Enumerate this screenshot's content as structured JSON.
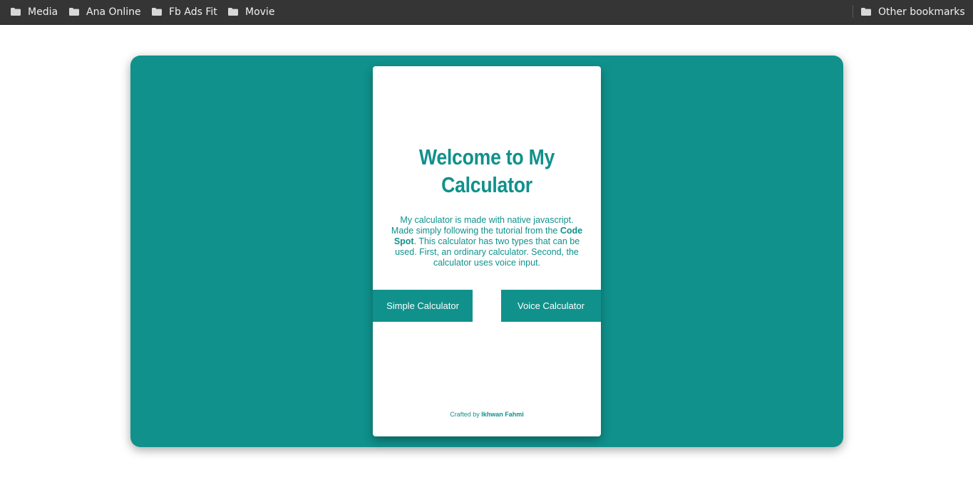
{
  "bookmarks": {
    "items": [
      {
        "label": "Media",
        "icon": "folder-icon"
      },
      {
        "label": "Ana Online",
        "icon": "folder-icon"
      },
      {
        "label": "Fb Ads Fit",
        "icon": "folder-icon"
      },
      {
        "label": "Movie",
        "icon": "folder-icon"
      }
    ],
    "other": {
      "label": "Other bookmarks",
      "icon": "folder-icon"
    }
  },
  "card": {
    "title": "Welcome to My Calculator",
    "description_part1": "My calculator is made with native javascript. Made simply following the tutorial from the ",
    "description_bold": "Code Spot",
    "description_part2": ". This calculator has two types that can be used. First, an ordinary calculator. Second, the calculator uses voice input.",
    "simple_button": "Simple Calculator",
    "voice_button": "Voice Calculator",
    "credit_prefix": "Crafted by ",
    "credit_name": "Ikhwan Fahmi"
  },
  "colors": {
    "accent": "#10918c",
    "bookmarks_bar": "#353535",
    "card": "#ffffff"
  }
}
